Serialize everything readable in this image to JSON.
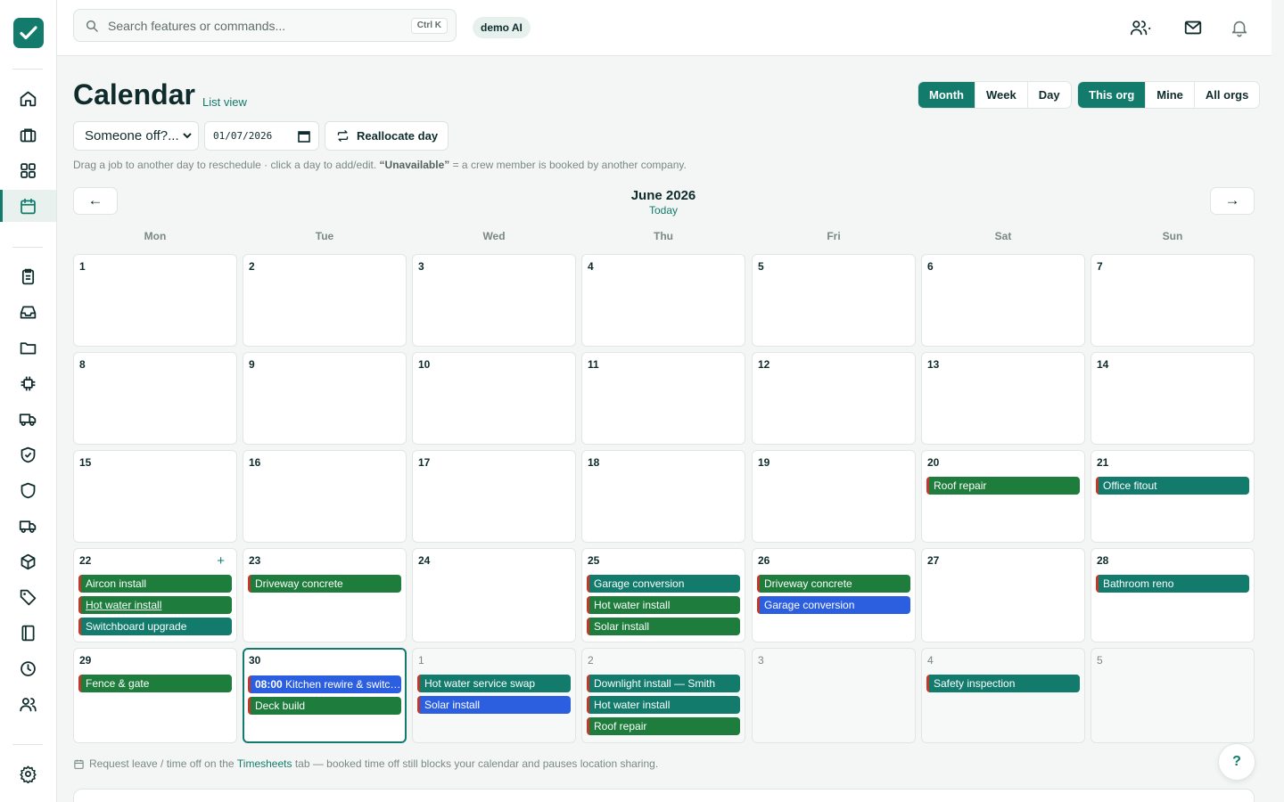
{
  "colors": {
    "accent": "#137b6c",
    "event_teal": "#137b6c",
    "event_green": "#1e7d3c",
    "event_blue": "#2c5fe0",
    "event_edge": "#c0392b"
  },
  "sidebar": {
    "icons": [
      "home-icon",
      "briefcase-icon",
      "grid-icon",
      "calendar-icon",
      "clipboard-icon",
      "inbox-icon",
      "folder-icon",
      "chip-icon",
      "truck-icon",
      "shield-check-icon",
      "shield-icon",
      "truck-icon",
      "box-icon",
      "tag-icon",
      "book-icon",
      "clock-icon",
      "users-icon",
      "settings-icon"
    ],
    "active": "calendar-icon"
  },
  "topbar": {
    "search_placeholder": "Search features or commands...",
    "shortcut": "Ctrl K",
    "org_badge": "demo AI"
  },
  "header": {
    "title": "Calendar",
    "list_view": "List view",
    "view_modes": [
      "Month",
      "Week",
      "Day"
    ],
    "active_view": "Month",
    "scopes": [
      "This org",
      "Mine",
      "All orgs"
    ],
    "active_scope": "This org"
  },
  "toolbar": {
    "select_value": "Someone off?...",
    "date_value": "01/07/2026",
    "reallocate_label": "Reallocate day"
  },
  "hint": {
    "pre": "Drag a job to another day to reschedule · click a day to add/edit.",
    "bold": "“Unavailable”",
    "post": "= a crew member is booked by another company."
  },
  "month": {
    "prev": "←",
    "next": "→",
    "name": "June 2026",
    "today_link": "Today",
    "weekdays": [
      "Mon",
      "Tue",
      "Wed",
      "Thu",
      "Fri",
      "Sat",
      "Sun"
    ]
  },
  "weeks": [
    [
      {
        "day": "1",
        "events": []
      },
      {
        "day": "2",
        "events": []
      },
      {
        "day": "3",
        "events": []
      },
      {
        "day": "4",
        "events": []
      },
      {
        "day": "5",
        "events": []
      },
      {
        "day": "6",
        "events": []
      },
      {
        "day": "7",
        "events": []
      }
    ],
    [
      {
        "day": "8",
        "events": []
      },
      {
        "day": "9",
        "events": []
      },
      {
        "day": "10",
        "events": []
      },
      {
        "day": "11",
        "events": []
      },
      {
        "day": "12",
        "events": []
      },
      {
        "day": "13",
        "events": []
      },
      {
        "day": "14",
        "events": []
      }
    ],
    [
      {
        "day": "15",
        "events": []
      },
      {
        "day": "16",
        "events": []
      },
      {
        "day": "17",
        "events": []
      },
      {
        "day": "18",
        "events": []
      },
      {
        "day": "19",
        "events": []
      },
      {
        "day": "20",
        "events": [
          {
            "title": "Roof repair",
            "color": "green"
          }
        ]
      },
      {
        "day": "21",
        "events": [
          {
            "title": "Office fitout",
            "color": "teal"
          }
        ]
      }
    ],
    [
      {
        "day": "22",
        "plus": "+",
        "events": [
          {
            "title": "Aircon install",
            "color": "green"
          },
          {
            "title": "Hot water install",
            "color": "green",
            "underline": true
          },
          {
            "title": "Switchboard upgrade",
            "color": "teal"
          }
        ]
      },
      {
        "day": "23",
        "events": [
          {
            "title": "Driveway concrete",
            "color": "green"
          }
        ]
      },
      {
        "day": "24",
        "events": []
      },
      {
        "day": "25",
        "events": [
          {
            "title": "Garage conversion",
            "color": "teal"
          },
          {
            "title": "Hot water install",
            "color": "green"
          },
          {
            "title": "Solar install",
            "color": "green"
          }
        ]
      },
      {
        "day": "26",
        "events": [
          {
            "title": "Driveway concrete",
            "color": "green"
          },
          {
            "title": "Garage conversion",
            "color": "blue"
          }
        ]
      },
      {
        "day": "27",
        "events": []
      },
      {
        "day": "28",
        "events": [
          {
            "title": "Bathroom reno",
            "color": "teal"
          }
        ]
      }
    ],
    [
      {
        "day": "29",
        "events": [
          {
            "title": "Fence & gate",
            "color": "green"
          }
        ]
      },
      {
        "day": "30",
        "today": true,
        "events": [
          {
            "time": "08:00",
            "title": "Kitchen rewire & switchboard",
            "color": "blue"
          },
          {
            "title": "Deck build",
            "color": "green"
          }
        ]
      },
      {
        "day": "1",
        "other": true,
        "events": [
          {
            "title": "Hot water service swap",
            "color": "teal"
          },
          {
            "title": "Solar install",
            "color": "blue"
          }
        ]
      },
      {
        "day": "2",
        "other": true,
        "events": [
          {
            "title": "Downlight install — Smith",
            "color": "teal"
          },
          {
            "title": "Hot water install",
            "color": "teal"
          },
          {
            "title": "Roof repair",
            "color": "green"
          }
        ]
      },
      {
        "day": "3",
        "other": true,
        "events": []
      },
      {
        "day": "4",
        "other": true,
        "events": [
          {
            "title": "Safety inspection",
            "color": "teal"
          }
        ]
      },
      {
        "day": "5",
        "other": true,
        "events": []
      }
    ]
  ],
  "footnote": {
    "pre": "Request leave / time off on the",
    "link": "Timesheets",
    "post": "tab — booked time off still blocks your calendar and pauses location sharing."
  },
  "help_label": "?"
}
